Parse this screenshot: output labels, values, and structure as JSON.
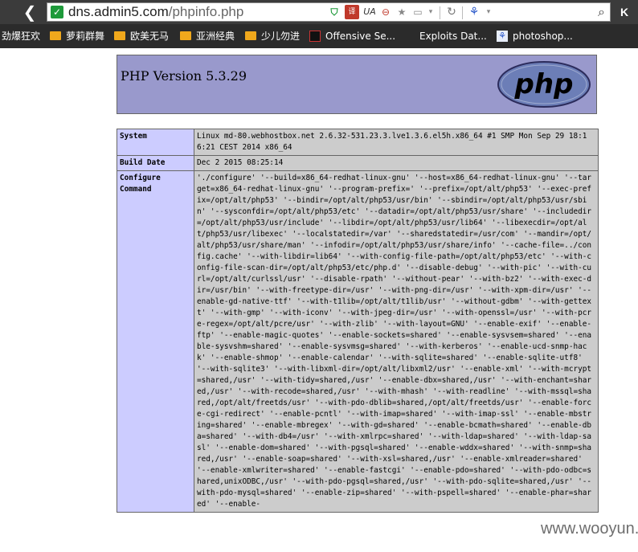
{
  "browser": {
    "url_host": "dns.admin5.com",
    "url_path": "/phpinfo.php",
    "k_label": "K",
    "bookmarks": [
      "劲爆狂欢",
      "萝莉群舞",
      "欧美无马",
      "亚洲经典",
      "少儿勿进",
      "Offensive Se...",
      "Exploits Dat...",
      "photoshop..."
    ]
  },
  "phpinfo": {
    "title": "PHP Version 5.3.29",
    "logo_text": "php",
    "rows": [
      {
        "label": "System",
        "value": "Linux md-80.webhostbox.net 2.6.32-531.23.3.lve1.3.6.el5h.x86_64 #1 SMP Mon Sep 29 18:16:21 CEST 2014 x86_64"
      },
      {
        "label": "Build Date",
        "value": "Dec 2 2015 08:25:14"
      },
      {
        "label": "Configure Command",
        "value": "'./configure' '--build=x86_64-redhat-linux-gnu' '--host=x86_64-redhat-linux-gnu' '--target=x86_64-redhat-linux-gnu' '--program-prefix=' '--prefix=/opt/alt/php53' '--exec-prefix=/opt/alt/php53' '--bindir=/opt/alt/php53/usr/bin' '--sbindir=/opt/alt/php53/usr/sbin' '--sysconfdir=/opt/alt/php53/etc' '--datadir=/opt/alt/php53/usr/share' '--includedir=/opt/alt/php53/usr/include' '--libdir=/opt/alt/php53/usr/lib64' '--libexecdir=/opt/alt/php53/usr/libexec' '--localstatedir=/var' '--sharedstatedir=/usr/com' '--mandir=/opt/alt/php53/usr/share/man' '--infodir=/opt/alt/php53/usr/share/info' '--cache-file=../config.cache' '--with-libdir=lib64' '--with-config-file-path=/opt/alt/php53/etc' '--with-config-file-scan-dir=/opt/alt/php53/etc/php.d' '--disable-debug' '--with-pic' '--with-curl=/opt/alt/curlssl/usr' '--disable-rpath' '--without-pear' '--with-bz2' '--with-exec-dir=/usr/bin' '--with-freetype-dir=/usr' '--with-png-dir=/usr' '--with-xpm-dir=/usr' '--enable-gd-native-ttf' '--with-t1lib=/opt/alt/t1lib/usr' '--without-gdbm' '--with-gettext' '--with-gmp' '--with-iconv' '--with-jpeg-dir=/usr' '--with-openssl=/usr' '--with-pcre-regex=/opt/alt/pcre/usr' '--with-zlib' '--with-layout=GNU' '--enable-exif' '--enable-ftp' '--enable-magic-quotes' '--enable-sockets=shared' '--enable-sysvsem=shared' '--enable-sysvshm=shared' '--enable-sysvmsg=shared' '--with-kerberos' '--enable-ucd-snmp-hack' '--enable-shmop' '--enable-calendar' '--with-sqlite=shared' '--enable-sqlite-utf8' '--with-sqlite3' '--with-libxml-dir=/opt/alt/libxml2/usr' '--enable-xml' '--with-mcrypt=shared,/usr' '--with-tidy=shared,/usr' '--enable-dbx=shared,/usr' '--with-enchant=shared,/usr' '--with-recode=shared,/usr' '--with-mhash' '--with-readline' '--with-mssql=shared,/opt/alt/freetds/usr' '--with-pdo-dblib=shared,/opt/alt/freetds/usr' '--enable-force-cgi-redirect' '--enable-pcntl' '--with-imap=shared' '--with-imap-ssl' '--enable-mbstring=shared' '--enable-mbregex' '--with-gd=shared' '--enable-bcmath=shared' '--enable-dba=shared' '--with-db4=/usr' '--with-xmlrpc=shared' '--with-ldap=shared' '--with-ldap-sasl' '--enable-dom=shared' '--with-pgsql=shared' '--enable-wddx=shared' '--with-snmp=shared,/usr' '--enable-soap=shared' '--with-xsl=shared,/usr' '--enable-xmlreader=shared' '--enable-xmlwriter=shared' '--enable-fastcgi' '--enable-pdo=shared' '--with-pdo-odbc=shared,unixODBC,/usr' '--with-pdo-pgsql=shared,/usr' '--with-pdo-sqlite=shared,/usr' '--with-pdo-mysql=shared' '--enable-zip=shared' '--with-pspell=shared' '--enable-phar=shared' '--enable-"
      }
    ]
  },
  "watermark": "www.wooyun.org",
  "colors": {
    "header_bg": "#9999cc",
    "label_bg": "#ccccff",
    "value_bg": "#cccccc"
  }
}
